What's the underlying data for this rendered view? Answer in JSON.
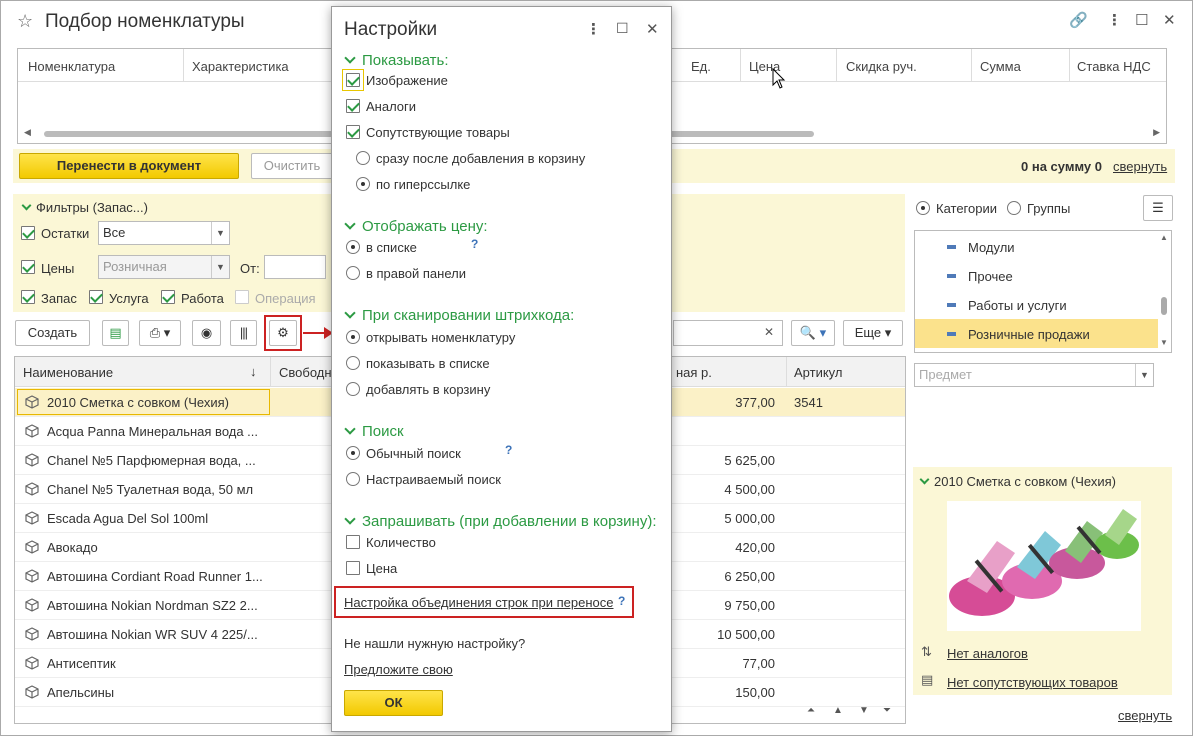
{
  "window": {
    "title": "Подбор номенклатуры"
  },
  "cart": {
    "columns": [
      "Номенклатура",
      "Характеристика",
      "Ед.",
      "Цена",
      "Скидка руч.",
      "Сумма",
      "Ставка НДС"
    ],
    "transfer_button": "Перенести в документ",
    "clear_button": "Очистить",
    "summary": "0 на сумму 0",
    "collapse_link": "свернуть"
  },
  "filters": {
    "title": "Фильтры (Запас...)",
    "stock_label": "Остатки",
    "stock_value": "Все",
    "prices_label": "Цены",
    "price_type_value": "Розничная",
    "from_label": "От:",
    "types": [
      {
        "label": "Запас",
        "checked": true
      },
      {
        "label": "Услуга",
        "checked": true
      },
      {
        "label": "Работа",
        "checked": true
      },
      {
        "label": "Операция",
        "checked": false
      }
    ]
  },
  "toolbar": {
    "create_button": "Создать",
    "more_button": "Еще"
  },
  "table": {
    "columns": {
      "name": "Наименование",
      "free": "Свободн",
      "price": "ная р.",
      "article": "Артикул"
    },
    "rows": [
      {
        "name": "2010 Сметка с совком (Чехия)",
        "price": "377,00",
        "article": "3541",
        "selected": true
      },
      {
        "name": "Acqua Panna Минеральная вода ...",
        "price": "",
        "article": ""
      },
      {
        "name": "Chanel №5 Парфюмерная вода, ...",
        "price": "5 625,00",
        "article": ""
      },
      {
        "name": "Chanel №5 Туалетная вода, 50 мл",
        "price": "4 500,00",
        "article": ""
      },
      {
        "name": "Escada Agua Del Sol 100ml",
        "price": "5 000,00",
        "article": ""
      },
      {
        "name": "Авокадо",
        "price": "420,00",
        "article": ""
      },
      {
        "name": "Автошина Cordiant Road Runner 1...",
        "price": "6 250,00",
        "article": ""
      },
      {
        "name": "Автошина Nokian Nordman SZ2 2...",
        "price": "9 750,00",
        "article": ""
      },
      {
        "name": "Автошина Nokian WR SUV 4 225/...",
        "price": "10 500,00",
        "article": ""
      },
      {
        "name": "Антисептик",
        "price": "77,00",
        "article": ""
      },
      {
        "name": "Апельсины",
        "price": "150,00",
        "article": ""
      }
    ]
  },
  "right_panel": {
    "categories_label": "Категории",
    "groups_label": "Группы",
    "category_items": [
      {
        "label": "Модули"
      },
      {
        "label": "Прочее"
      },
      {
        "label": "Работы и услуги"
      },
      {
        "label": "Розничные продажи",
        "selected": true
      }
    ],
    "subject_placeholder": "Предмет",
    "product_title": "2010 Сметка с совком (Чехия)",
    "no_analogs": "Нет аналогов",
    "no_related": "Нет сопутствующих товаров",
    "collapse_link": "свернуть"
  },
  "dialog": {
    "title": "Настройки",
    "show_section": "Показывать:",
    "show_image": "Изображение",
    "show_analogs": "Аналоги",
    "show_related": "Сопутствующие товары",
    "related_after_add": "сразу после добавления в корзину",
    "related_by_link": "по гиперссылке",
    "price_section": "Отображать цену:",
    "price_in_list": "в списке",
    "price_in_panel": "в правой панели",
    "barcode_section": "При сканировании штрихкода:",
    "barcode_open": "открывать номенклатуру",
    "barcode_show": "показывать в списке",
    "barcode_add": "добавлять в корзину",
    "search_section": "Поиск",
    "search_normal": "Обычный поиск",
    "search_custom": "Настраиваемый поиск",
    "ask_section": "Запрашивать (при добавлении в корзину):",
    "ask_quantity": "Количество",
    "ask_price": "Цена",
    "merge_link": "Настройка объединения строк при переносе",
    "help_mark": "?",
    "not_found_text": "Не нашли нужную настройку?",
    "suggest_link": "Предложите свою",
    "ok_button": "ОК"
  },
  "colors": {
    "accent_green": "#2c9a43",
    "highlight_yellow": "#fbf7d6",
    "button_yellow": "#f2c900",
    "annotation_red": "#cc2222"
  }
}
